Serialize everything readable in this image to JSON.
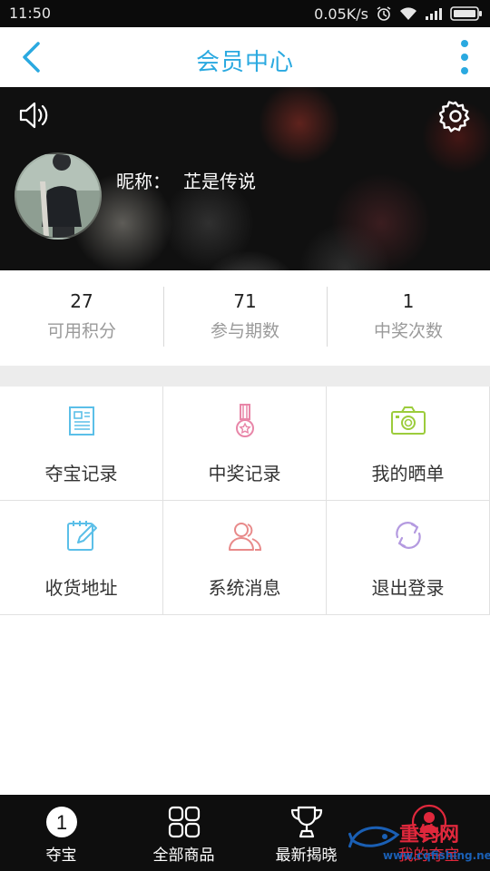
{
  "status_bar": {
    "time": "11:50",
    "speed": "0.05K/s",
    "icons": [
      "alarm-icon",
      "wifi-icon",
      "signal-icon",
      "battery-icon"
    ]
  },
  "header": {
    "title": "会员中心",
    "back_icon": "chevron-left-icon",
    "more_icon": "more-vertical-icon",
    "accent_color": "#2aa9e0"
  },
  "profile": {
    "nickname_label": "昵称：",
    "nickname": "芷是传说",
    "sound_icon": "speaker-icon",
    "settings_icon": "gear-icon"
  },
  "stats": [
    {
      "value": "27",
      "label": "可用积分"
    },
    {
      "value": "71",
      "label": "参与期数"
    },
    {
      "value": "1",
      "label": "中奖次数"
    }
  ],
  "menu": [
    {
      "label": "夺宝记录",
      "icon": "document-icon",
      "color": "#5bbfe8"
    },
    {
      "label": "中奖记录",
      "icon": "medal-icon",
      "color": "#e886a8"
    },
    {
      "label": "我的晒单",
      "icon": "camera-icon",
      "color": "#9ccc3c"
    },
    {
      "label": "收货地址",
      "icon": "notebook-pencil-icon",
      "color": "#5bbfe8"
    },
    {
      "label": "系统消息",
      "icon": "users-icon",
      "color": "#e88a8a"
    },
    {
      "label": "退出登录",
      "icon": "refresh-icon",
      "color": "#b49ae0"
    }
  ],
  "bottom_nav": [
    {
      "label": "夺宝",
      "icon": "number-one-icon",
      "badge": "1"
    },
    {
      "label": "全部商品",
      "icon": "grid-icon"
    },
    {
      "label": "最新揭晓",
      "icon": "trophy-icon"
    },
    {
      "label": "我的夺宝",
      "icon": "user-icon",
      "active": true
    }
  ],
  "watermark": {
    "text": "重钓网",
    "url": "www.cqfishing.net"
  }
}
